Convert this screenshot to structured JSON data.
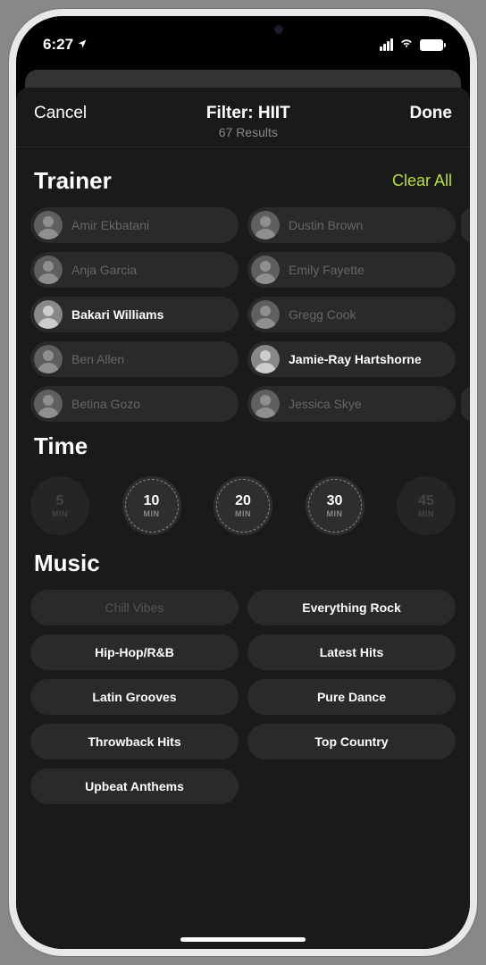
{
  "status": {
    "time": "6:27"
  },
  "header": {
    "cancel": "Cancel",
    "done": "Done",
    "title": "Filter: HIIT",
    "subtitle": "67 Results"
  },
  "sections": {
    "trainer": {
      "title": "Trainer",
      "clear": "Clear All",
      "items": [
        {
          "name": "Amir Ekbatani",
          "selected": false
        },
        {
          "name": "Dustin Brown",
          "selected": false
        },
        {
          "name": "Anja Garcia",
          "selected": false
        },
        {
          "name": "Emily Fayette",
          "selected": false
        },
        {
          "name": "Bakari Williams",
          "selected": true
        },
        {
          "name": "Gregg Cook",
          "selected": false
        },
        {
          "name": "Ben Allen",
          "selected": false
        },
        {
          "name": "Jamie-Ray Hartshorne",
          "selected": true
        },
        {
          "name": "Betina Gozo",
          "selected": false
        },
        {
          "name": "Jessica Skye",
          "selected": false
        }
      ]
    },
    "time": {
      "title": "Time",
      "unit": "MIN",
      "items": [
        {
          "value": "5",
          "selected": false,
          "available": false
        },
        {
          "value": "10",
          "selected": true,
          "available": true
        },
        {
          "value": "20",
          "selected": true,
          "available": true
        },
        {
          "value": "30",
          "selected": true,
          "available": true
        },
        {
          "value": "45",
          "selected": false,
          "available": false
        }
      ]
    },
    "music": {
      "title": "Music",
      "items": [
        {
          "name": "Chill Vibes",
          "available": false
        },
        {
          "name": "Everything Rock",
          "available": true
        },
        {
          "name": "Hip-Hop/R&B",
          "available": true
        },
        {
          "name": "Latest Hits",
          "available": true
        },
        {
          "name": "Latin Grooves",
          "available": true
        },
        {
          "name": "Pure Dance",
          "available": true
        },
        {
          "name": "Throwback Hits",
          "available": true
        },
        {
          "name": "Top Country",
          "available": true
        },
        {
          "name": "Upbeat Anthems",
          "available": true
        }
      ]
    }
  }
}
